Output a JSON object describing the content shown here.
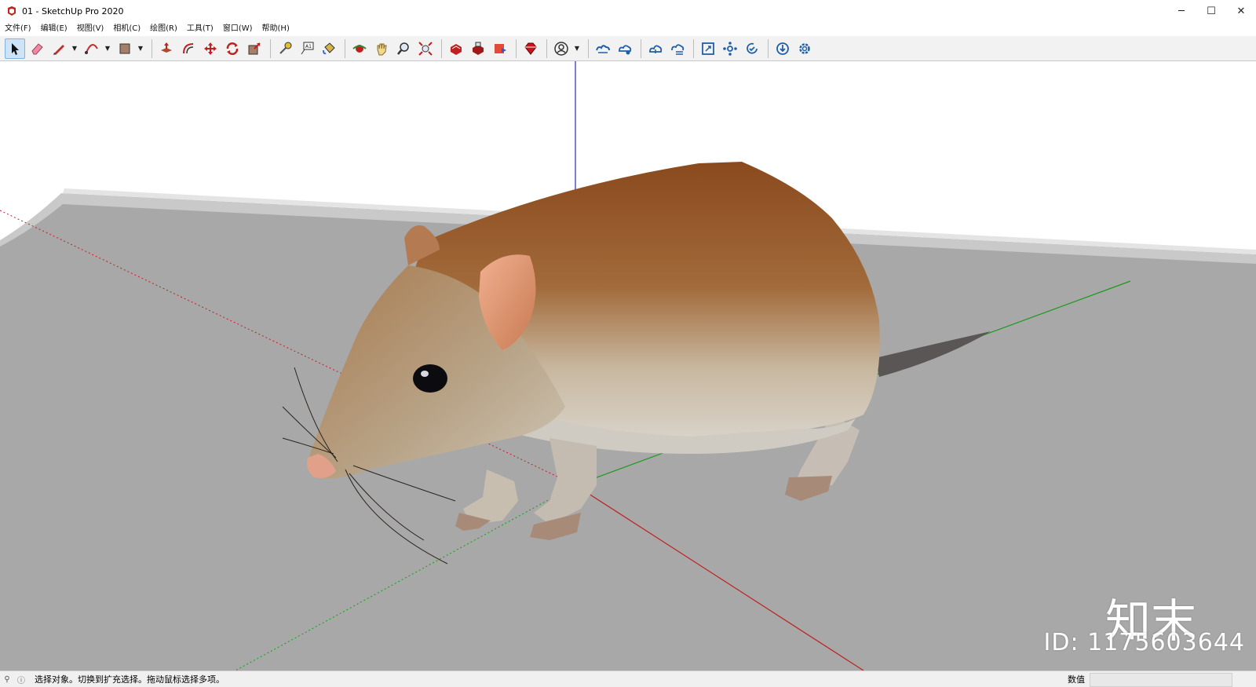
{
  "window": {
    "title": "01 - SketchUp Pro 2020",
    "minimize_glyph": "─",
    "maximize_glyph": "☐",
    "close_glyph": "✕",
    "app_icon": "sketchup-logo-icon"
  },
  "menu": {
    "items": [
      "文件(F)",
      "编辑(E)",
      "视图(V)",
      "相机(C)",
      "绘图(R)",
      "工具(T)",
      "窗口(W)",
      "帮助(H)"
    ]
  },
  "toolbar": {
    "tools": [
      {
        "name": "select",
        "icon": "select-arrow-icon",
        "active": true
      },
      {
        "name": "eraser",
        "icon": "eraser-icon"
      },
      {
        "name": "line",
        "icon": "pencil-icon",
        "dropdown": true
      },
      {
        "name": "arc",
        "icon": "arc-icon",
        "dropdown": true
      },
      {
        "name": "shapes",
        "icon": "rectangle-icon",
        "dropdown": true
      },
      {
        "name": "push-pull",
        "icon": "push-pull-icon"
      },
      {
        "name": "offset",
        "icon": "offset-icon"
      },
      {
        "name": "move",
        "icon": "move-icon"
      },
      {
        "name": "rotate",
        "icon": "rotate-icon"
      },
      {
        "name": "scale",
        "icon": "scale-icon"
      },
      {
        "name": "tape-measure",
        "icon": "tape-measure-icon"
      },
      {
        "name": "text",
        "icon": "text-icon"
      },
      {
        "name": "paint-bucket",
        "icon": "paint-bucket-icon"
      },
      {
        "name": "orbit",
        "icon": "orbit-icon"
      },
      {
        "name": "pan",
        "icon": "pan-hand-icon"
      },
      {
        "name": "zoom",
        "icon": "zoom-icon"
      },
      {
        "name": "zoom-extents",
        "icon": "zoom-extents-icon"
      },
      {
        "name": "warehouse",
        "icon": "3d-warehouse-icon"
      },
      {
        "name": "extension-warehouse",
        "icon": "extension-warehouse-icon"
      },
      {
        "name": "send-to-layout",
        "icon": "layout-icon"
      },
      {
        "name": "extension-manager",
        "icon": "ruby-icon"
      },
      {
        "name": "account",
        "icon": "account-icon",
        "dropdown": true
      },
      {
        "name": "trimble-connect-sync",
        "icon": "cloud-sync-icon"
      },
      {
        "name": "trimble-connect-share",
        "icon": "cloud-share-icon"
      },
      {
        "name": "trimble-connect-open",
        "icon": "cloud-open-icon"
      },
      {
        "name": "trimble-connect-list",
        "icon": "cloud-list-icon"
      },
      {
        "name": "resize-window",
        "icon": "resize-icon"
      },
      {
        "name": "model-info",
        "icon": "settings-cluster-icon"
      },
      {
        "name": "check-validity",
        "icon": "check-refresh-icon"
      },
      {
        "name": "download",
        "icon": "download-icon"
      },
      {
        "name": "preferences",
        "icon": "gear-icon"
      }
    ]
  },
  "viewport": {
    "watermark_logo": "知末",
    "watermark_id": "ID: 1175603644",
    "axis_colors": {
      "red": "#c02020",
      "green": "#1a9a1a",
      "blue": "#2a2aa0"
    },
    "model": "rat-3d-model"
  },
  "statusbar": {
    "message": "选择对象。切换到扩充选择。拖动鼠标选择多项。",
    "measurements_label": "数值",
    "measurements_value": ""
  }
}
